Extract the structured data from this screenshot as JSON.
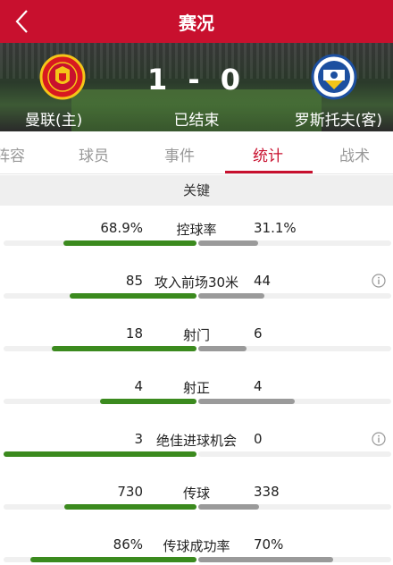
{
  "header": {
    "title": "赛况",
    "back_icon": "chevron-left-icon"
  },
  "match": {
    "home_name": "曼联(主)",
    "away_name": "罗斯托夫(客)",
    "score": "1 - 0",
    "status": "已结束",
    "home_crest": "manchester-united-crest",
    "away_crest": "rostov-crest"
  },
  "tabs": [
    {
      "label": "阵容",
      "active": false
    },
    {
      "label": "球员",
      "active": false
    },
    {
      "label": "事件",
      "active": false
    },
    {
      "label": "统计",
      "active": true
    },
    {
      "label": "战术",
      "active": false
    }
  ],
  "section": {
    "title": "关键"
  },
  "colors": {
    "accent": "#c8102e",
    "home_bar": "#3b8a1e",
    "away_bar": "#9a9a9a"
  },
  "stats": [
    {
      "label": "控球率",
      "home": "68.9%",
      "away": "31.1%",
      "home_pct": 68.9,
      "away_pct": 31.1,
      "info": false
    },
    {
      "label": "攻入前场30米",
      "home": "85",
      "away": "44",
      "home_pct": 65.9,
      "away_pct": 34.1,
      "info": true
    },
    {
      "label": "射门",
      "home": "18",
      "away": "6",
      "home_pct": 75,
      "away_pct": 25,
      "info": false
    },
    {
      "label": "射正",
      "home": "4",
      "away": "4",
      "home_pct": 50,
      "away_pct": 50,
      "info": false
    },
    {
      "label": "绝佳进球机会",
      "home": "3",
      "away": "0",
      "home_pct": 100,
      "away_pct": 0,
      "info": true
    },
    {
      "label": "传球",
      "home": "730",
      "away": "338",
      "home_pct": 68.4,
      "away_pct": 31.6,
      "info": false
    },
    {
      "label": "传球成功率",
      "home": "86%",
      "away": "70%",
      "home_pct": 86,
      "away_pct": 70,
      "info": false
    }
  ]
}
